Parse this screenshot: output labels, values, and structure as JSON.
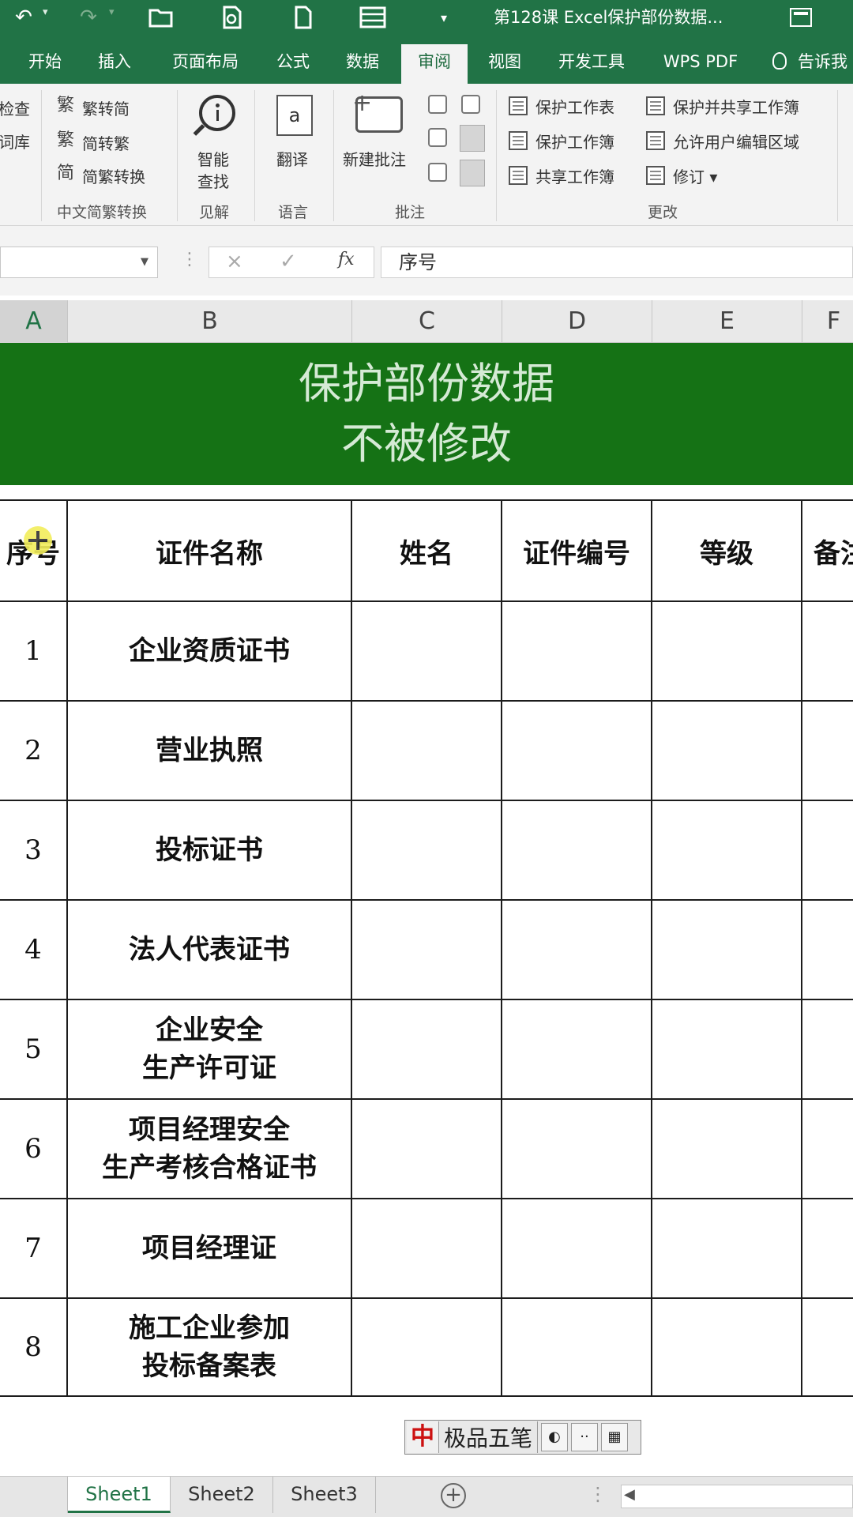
{
  "window": {
    "title": "第128课 Excel保护部份数据..."
  },
  "qat": {
    "undo_icon": "undo-icon",
    "redo_icon": "redo-icon",
    "open_icon": "folder-open-icon",
    "preview_icon": "print-preview-icon",
    "new_icon": "new-document-icon",
    "form_icon": "form-icon",
    "customize_icon": "dropdown-icon"
  },
  "ribbon": {
    "tabs": [
      "开始",
      "插入",
      "页面布局",
      "公式",
      "数据",
      "审阅",
      "视图",
      "开发工具",
      "WPS PDF",
      "告诉我"
    ],
    "active_tab": "审阅",
    "proofing": {
      "item1": "检查",
      "item2": "词库"
    },
    "chinese_conversion": {
      "to_traditional": "繁转简",
      "to_simplified": "简转繁",
      "convert": "简繁转换",
      "group": "中文简繁转换"
    },
    "insights": {
      "smart_lookup_line1": "智能",
      "smart_lookup_line2": "查找",
      "group": "见解"
    },
    "language": {
      "translate": "翻译",
      "group": "语言"
    },
    "comments": {
      "new_comment": "新建批注",
      "group": "批注"
    },
    "changes": {
      "protect_sheet": "保护工作表",
      "protect_workbook": "保护工作簿",
      "share_workbook": "共享工作簿",
      "protect_share": "保护并共享工作簿",
      "allow_edit_ranges": "允许用户编辑区域",
      "track_changes": "修订 ▾",
      "group": "更改"
    }
  },
  "formula_bar": {
    "cancel": "×",
    "enter": "✓",
    "fx": "fx",
    "value": "序号"
  },
  "columns": [
    "A",
    "B",
    "C",
    "D",
    "E",
    "F"
  ],
  "selected_column": "A",
  "banner": {
    "line1": "保护部份数据",
    "line2": "不被修改"
  },
  "table": {
    "headers": [
      "序号",
      "证件名称",
      "姓名",
      "证件编号",
      "等级",
      "备注"
    ],
    "rows": [
      {
        "no": "1",
        "name": "企业资质证书"
      },
      {
        "no": "2",
        "name": "营业执照"
      },
      {
        "no": "3",
        "name": "投标证书"
      },
      {
        "no": "4",
        "name": "法人代表证书"
      },
      {
        "no": "5",
        "name": "企业安全\n生产许可证"
      },
      {
        "no": "6",
        "name": "项目经理安全\n生产考核合格证书"
      },
      {
        "no": "7",
        "name": "项目经理证"
      },
      {
        "no": "8",
        "name": "施工企业参加\n投标备案表"
      }
    ]
  },
  "ime": {
    "name": "极品五笔",
    "logo": "中"
  },
  "sheets": [
    "Sheet1",
    "Sheet2",
    "Sheet3"
  ],
  "active_sheet": "Sheet1",
  "colors": {
    "excel_green": "#217346",
    "banner_green": "#157215",
    "banner_text": "#d5ead5"
  }
}
